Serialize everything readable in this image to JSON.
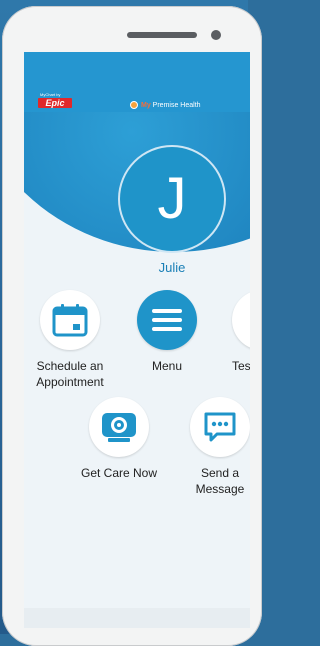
{
  "header": {
    "mychart_by": "MyChart by",
    "epic_logo": "Epic",
    "brand_my": "My",
    "brand_rest": " Premise Health"
  },
  "user": {
    "initial": "J",
    "name": "Julie"
  },
  "actions": [
    {
      "label": "Schedule an\nAppointment",
      "icon": "calendar-icon"
    },
    {
      "label": "Menu",
      "icon": "menu-icon"
    },
    {
      "label": "Tes",
      "icon": "test-results-icon"
    },
    {
      "label": "Get Care Now",
      "icon": "webcam-icon"
    },
    {
      "label": "Send a\nMessage",
      "icon": "message-icon"
    }
  ],
  "colors": {
    "accent": "#1f94c9",
    "header": "#2596d0",
    "background": "#2d6e9c"
  }
}
